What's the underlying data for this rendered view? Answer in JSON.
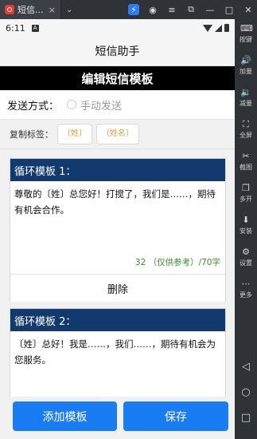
{
  "emulator": {
    "tab_title": "短信...",
    "tab_close": "×",
    "chevron": "⌄",
    "toolbar": [
      {
        "icon": "keyboard-icon",
        "glyph": "⌨",
        "label": "按键"
      },
      {
        "icon": "volume-up-icon",
        "glyph": "🔊",
        "label": "加量"
      },
      {
        "icon": "volume-down-icon",
        "glyph": "🔉",
        "label": "减量"
      },
      {
        "icon": "fullscreen-icon",
        "glyph": "⛶",
        "label": "全屏"
      },
      {
        "icon": "scissors-icon",
        "glyph": "✂",
        "label": "截图"
      },
      {
        "icon": "multi-open-icon",
        "glyph": "❐",
        "label": "多开"
      },
      {
        "icon": "install-icon",
        "glyph": "⬇",
        "label": "安装"
      },
      {
        "icon": "settings-icon",
        "glyph": "⚙",
        "label": "设置"
      },
      {
        "icon": "more-icon",
        "glyph": "⋯",
        "label": "更多"
      }
    ],
    "nav": {
      "back": "◁",
      "home": "○",
      "recents": "□"
    }
  },
  "status_bar": {
    "time": "6:11",
    "a_badge": "A"
  },
  "app_bar": {
    "title": "短信助手"
  },
  "banner": {
    "title": "编辑短信模板"
  },
  "send_method": {
    "label": "发送方式：",
    "option": "手动发送"
  },
  "copy_tags": {
    "label": "复制标签：",
    "tags": [
      "〔姓〕",
      "〔姓名〕"
    ]
  },
  "templates": [
    {
      "title": "循环模板 1：",
      "text": "尊敬的〔姓〕总您好！打搅了，我们是……，期待有机会合作。",
      "count": "32 （仅供参考）/70字",
      "delete_label": "删除"
    },
    {
      "title": "循环模板 2：",
      "text": "〔姓〕总好！我是……，我们……，期待有机会为您服务。"
    }
  ],
  "actions": {
    "add": "添加模板",
    "save": "保存"
  },
  "colors": {
    "accent": "#1a7cf2",
    "card_header": "#133a6e",
    "tag_text": "#d9a04a",
    "count_text": "#3b8a2f"
  }
}
